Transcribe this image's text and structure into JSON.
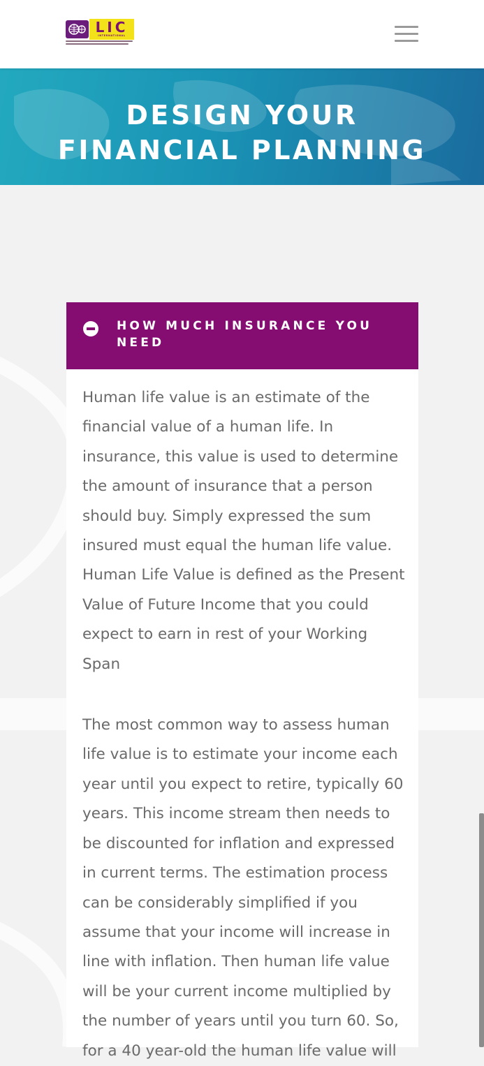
{
  "header": {
    "logo": {
      "brand_letters": "LIC",
      "brand_subtitle": "INTERNATIONAL",
      "alt": "LIC International logo"
    },
    "menu_icon": "hamburger-menu-icon"
  },
  "hero": {
    "title_line1": "Design Your",
    "title_line2": "Financial Planning"
  },
  "accordion": {
    "toggle_icon": "minus-circle-icon",
    "title": "How Much Insurance You Need",
    "paragraphs": [
      "Human life value is an estimate of the financial value of a human life. In insurance, this value is used to determine the amount of insurance that a person should buy. Simply expressed the sum insured must equal the human life value. Human Life Value is defined as the Present Value of Future Income that you could expect to earn in rest of your Working Span",
      "The most common way to assess human life value is to estimate your income each year until you expect to retire, typically 60 years. This income stream then needs to be discounted for inflation and expressed in current terms. The estimation process can be considerably simplified if you assume that your income will increase in line with inflation. Then human life value will be your current income multiplied by the number of years until you turn 60. So, for a 40 year-old the human life value will"
    ]
  },
  "colors": {
    "accent_purple": "#850d72",
    "hero_teal": "#23a9bf",
    "hero_blue": "#1a6c9e",
    "logo_yellow": "#f3e21a",
    "body_text": "#6a6a6a"
  }
}
